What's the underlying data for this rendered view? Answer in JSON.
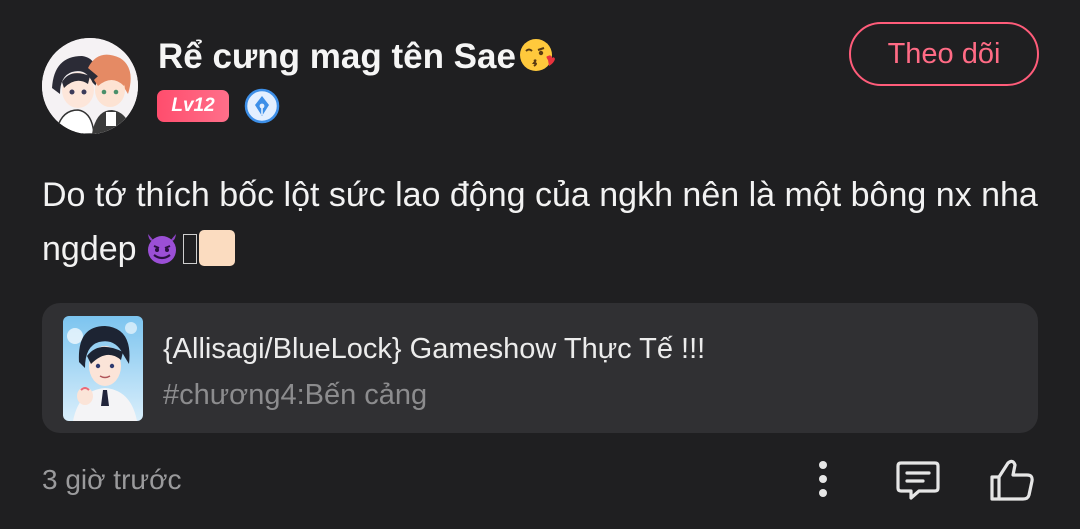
{
  "post": {
    "author": {
      "name": "Rể cưng mag tên Sae",
      "level": "Lv12",
      "avatar_icon": "anime-couple-avatar",
      "verified_icon": "pen-nib-badge-icon"
    },
    "follow_label": "Theo dõi",
    "content": {
      "text": "Do tớ thích bốc lột sức lao động của ngkh nên là một bông nx nha ngdep",
      "emojis": [
        "smiling-devil",
        "missing-glyph",
        "light-skin-tone"
      ]
    },
    "story": {
      "title": "{Allisagi/BlueLock} Gameshow Thực Tế !!!",
      "chapter": "#chương4:Bến cảng",
      "cover_icon": "anime-boy-cover"
    },
    "timestamp": "3 giờ trước",
    "actions": [
      "more-icon",
      "comment-icon",
      "like-icon"
    ]
  },
  "colors": {
    "background": "#1f1f21",
    "accent": "#ff5c7a",
    "card": "#303033",
    "muted_text": "#9a9a9c",
    "badge": "#ff4d6d",
    "verified": "#3d8fe8"
  }
}
